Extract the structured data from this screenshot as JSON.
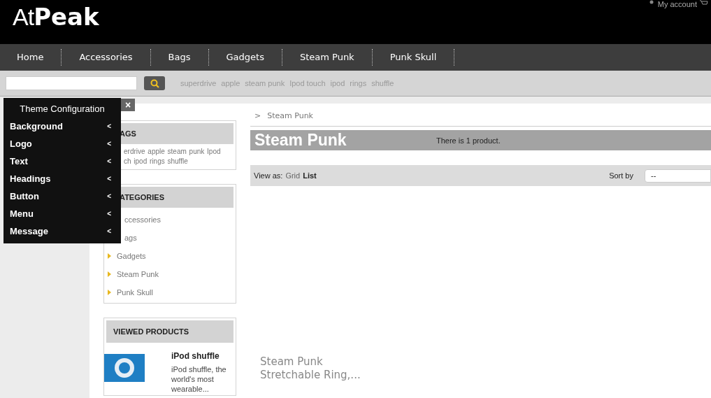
{
  "header": {
    "logo_light": "At",
    "logo_bold": "Peak",
    "account_link": "My account"
  },
  "nav": {
    "items": [
      "Home",
      "Accessories",
      "Bags",
      "Gadgets",
      "Steam Punk",
      "Punk Skull"
    ]
  },
  "search": {
    "tags": [
      "superdrive",
      "apple",
      "steam punk",
      "Ipod touch",
      "ipod",
      "rings",
      "shuffle"
    ]
  },
  "theme_panel": {
    "title": "Theme Configuration",
    "close": "×",
    "items": [
      {
        "label": "Background",
        "arrow": "<"
      },
      {
        "label": "Logo",
        "arrow": "<"
      },
      {
        "label": "Text",
        "arrow": "<"
      },
      {
        "label": "Headings",
        "arrow": "<"
      },
      {
        "label": "Button",
        "arrow": "<"
      },
      {
        "label": "Menu",
        "arrow": "<"
      },
      {
        "label": "Message",
        "arrow": "<"
      }
    ]
  },
  "sidebar": {
    "tags_block": {
      "title": "AGS",
      "lines": [
        "erdrive  apple  steam punk  Ipod",
        "ch  ipod  rings  shuffle"
      ]
    },
    "categories_block": {
      "title": "ATEGORIES",
      "items": [
        {
          "label": "ccessories",
          "arrow": false
        },
        {
          "label": "ags",
          "arrow": false
        },
        {
          "label": "Gadgets",
          "arrow": true
        },
        {
          "label": "Steam Punk",
          "arrow": true
        },
        {
          "label": "Punk Skull",
          "arrow": true
        }
      ]
    },
    "viewed_block": {
      "title": "VIEWED PRODUCTS",
      "product": {
        "name": "iPod shuffle",
        "description": "iPod shuffle, the world's most wearable..."
      }
    }
  },
  "main": {
    "breadcrumb": {
      "separator": ">",
      "current": "Steam Punk"
    },
    "heading": "Steam Punk",
    "count": "There is 1 product.",
    "view_label": "View as:",
    "view_options": [
      {
        "label": "Grid",
        "selected": false
      },
      {
        "label": "List",
        "selected": true
      }
    ],
    "sort_label": "Sort by",
    "sort_value": "--",
    "product_name": "Steam Punk Stretchable Ring,..."
  }
}
